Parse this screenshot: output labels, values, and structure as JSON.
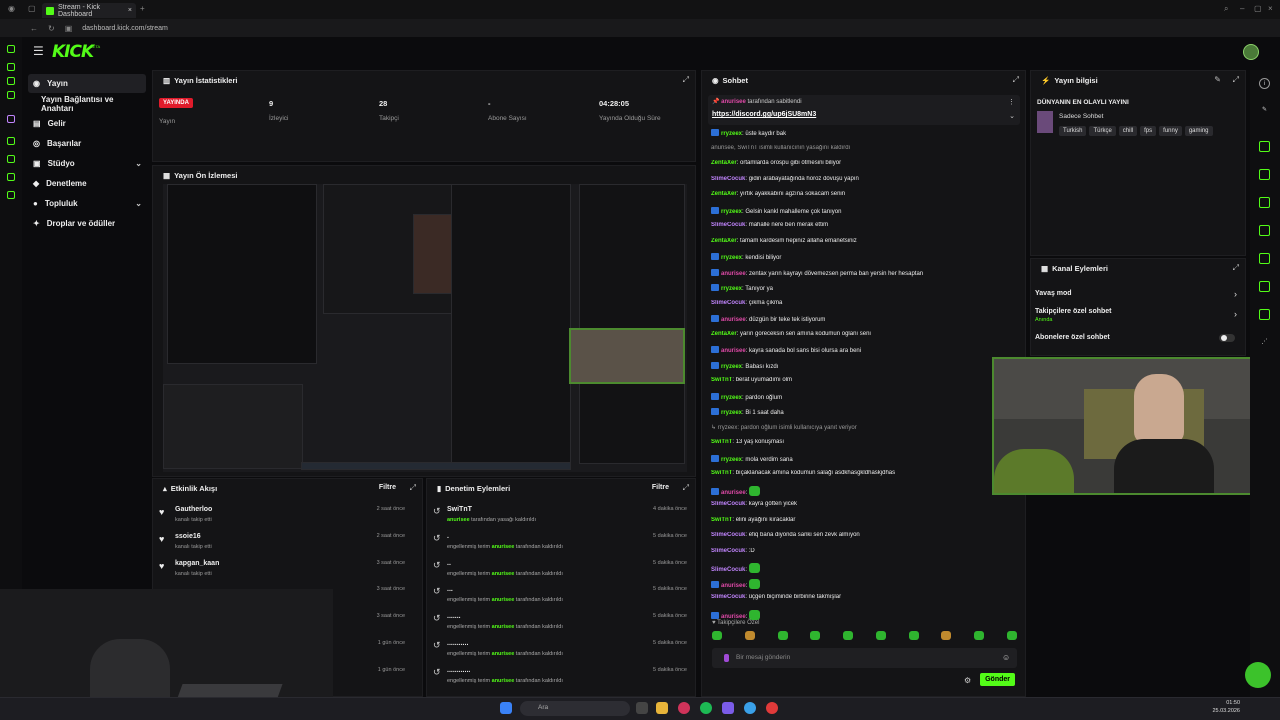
{
  "browser": {
    "tab_title": "Stream - Kick Dashboard",
    "url": "dashboard.kick.com/stream",
    "new_tab_icon": "plus-icon"
  },
  "header": {
    "logo": "KICK",
    "beta": "BETA"
  },
  "sidebar": {
    "items": [
      {
        "label": "Yayın",
        "icon": "broadcast-icon",
        "active": true
      },
      {
        "label": "Yayın Bağlantısı ve Anahtarı",
        "icon": ""
      },
      {
        "label": "Gelir",
        "icon": "money-icon"
      },
      {
        "label": "Başarılar",
        "icon": "trophy-icon"
      },
      {
        "label": "Stüdyo",
        "icon": "studio-icon",
        "chev": "⌄"
      },
      {
        "label": "Denetleme",
        "icon": "shield-icon"
      },
      {
        "label": "Topluluk",
        "icon": "community-icon",
        "chev": "⌄"
      },
      {
        "label": "Droplar ve ödüller",
        "icon": "gift-icon"
      }
    ]
  },
  "stats": {
    "title": "Yayın İstatistikleri",
    "items": [
      {
        "value": "YAYINDA",
        "label": "Yayın"
      },
      {
        "value": "9",
        "label": "İzleyici"
      },
      {
        "value": "28",
        "label": "Takipçi"
      },
      {
        "value": "-",
        "label": "Abone Sayısı"
      },
      {
        "value": "04:28:05",
        "label": "Yayında Olduğu Süre"
      }
    ]
  },
  "preview": {
    "title": "Yayın Ön İzlemesi"
  },
  "activity": {
    "title": "Etkinlik Akışı",
    "filter": "Filtre",
    "rows": [
      {
        "name": "Gautherloo",
        "sub": "kanalı takip etti",
        "time": "2 saat önce"
      },
      {
        "name": "ssoie16",
        "sub": "kanalı takip etti",
        "time": "2 saat önce"
      },
      {
        "name": "kapgan_kaan",
        "sub": "kanalı takip etti",
        "time": "3 saat önce"
      },
      {
        "name": "",
        "sub": "",
        "time": "3 saat önce"
      },
      {
        "name": "",
        "sub": "",
        "time": "3 saat önce"
      },
      {
        "name": "",
        "sub": "",
        "time": "1 gün önce"
      },
      {
        "name": "",
        "sub": "",
        "time": "1 gün önce"
      }
    ]
  },
  "moderation": {
    "title": "Denetim Eylemleri",
    "filter": "Filtre",
    "rows": [
      {
        "name": "SwiTnT",
        "pre": "",
        "who": "anurisee",
        "post": "tarafından yasağı kaldırıldı",
        "time": "4 dakika önce"
      },
      {
        "name": ".",
        "pre": "engellenmiş terim",
        "who": "anurisee",
        "post": "tarafından kaldırıldı",
        "time": "5 dakika önce"
      },
      {
        "name": "..",
        "pre": "engellenmiş terim",
        "who": "anurisee",
        "post": "tarafından kaldırıldı",
        "time": "5 dakika önce"
      },
      {
        "name": "...",
        "pre": "engellenmiş terim",
        "who": "anurisee",
        "post": "tarafından kaldırıldı",
        "time": "5 dakika önce"
      },
      {
        "name": ".......",
        "pre": "engellenmiş terim",
        "who": "anurisee",
        "post": "tarafından kaldırıldı",
        "time": "5 dakika önce"
      },
      {
        "name": "...........",
        "pre": "engellenmiş terim",
        "who": "anurisee",
        "post": "tarafından kaldırıldı",
        "time": "5 dakika önce"
      },
      {
        "name": "............",
        "pre": "engellenmiş terim",
        "who": "anurisee",
        "post": "tarafından kaldırıldı",
        "time": "5 dakika önce"
      }
    ]
  },
  "chat": {
    "title": "Sohbet",
    "pinned_by": "anurisee",
    "pinned_label": "tarafından sabitlendi",
    "pinned_link": "https://discord.gg/up6jSU8mN3",
    "placeholder": "Bir mesaj gönderin",
    "send": "Gönder",
    "followers_only": "Takipçilere Özel",
    "messages": [
      {
        "user": "rryzeex",
        "color": "#53fc18",
        "badge": true,
        "text": "üste kaydır bak"
      },
      {
        "user": "",
        "color": "#999",
        "badge": false,
        "text": "anurisee, SwiTnT isimli kullanıcının yasağını kaldırdı",
        "sys": true
      },
      {
        "user": "ZentaXer",
        "color": "#53fc18",
        "badge": false,
        "text": "ortamlarda orospu gibi ötmesini biliyor"
      },
      {
        "user": "SlimeCocuk",
        "color": "#c084fc",
        "badge": false,
        "text": "gidin arabayatağında horoz dövüşü yapın"
      },
      {
        "user": "ZentaXer",
        "color": "#53fc18",
        "badge": false,
        "text": "yırtık ayakkabını agzına sokacam senin"
      },
      {
        "user": "rryzeex",
        "color": "#53fc18",
        "badge": true,
        "text": "Gelsin kankl mahalleme çok tanıyon"
      },
      {
        "user": "SlimeCocuk",
        "color": "#c084fc",
        "badge": false,
        "text": "mahalle nere ben merak ettim"
      },
      {
        "user": "ZentaXer",
        "color": "#53fc18",
        "badge": false,
        "text": "tamam kardesim hepinız allaha emanetsiniz"
      },
      {
        "user": "rryzeex",
        "color": "#53fc18",
        "badge": true,
        "text": "kendisi biliyor"
      },
      {
        "user": "anurisee",
        "color": "#e04aa8",
        "badge": true,
        "text": "zentax yarın kayrayı dövemezsen perma ban yersin her hesaptan"
      },
      {
        "user": "rryzeex",
        "color": "#53fc18",
        "badge": true,
        "text": "Tanıyor ya"
      },
      {
        "user": "SlimeCocuk",
        "color": "#c084fc",
        "badge": false,
        "text": "çıkma çıkma"
      },
      {
        "user": "anurisee",
        "color": "#e04aa8",
        "badge": true,
        "text": "düzgün bir teke tek istiyorum"
      },
      {
        "user": "ZentaXer",
        "color": "#53fc18",
        "badge": false,
        "text": "yarın goreceksin sen amına kodumun oglanı seni"
      },
      {
        "user": "anurisee",
        "color": "#e04aa8",
        "badge": true,
        "text": "kayra sanada bol sans bisi olursa ara beni"
      },
      {
        "user": "rryzeex",
        "color": "#53fc18",
        "badge": true,
        "text": "Babası kızdı"
      },
      {
        "user": "SwiTnT",
        "color": "#53fc18",
        "badge": false,
        "text": "berat uyumadımı olm"
      },
      {
        "user": "rryzeex",
        "color": "#53fc18",
        "badge": true,
        "text": "pardon oğlum"
      },
      {
        "user": "rryzeex",
        "color": "#53fc18",
        "badge": true,
        "text": "Bi 1 saat daha"
      },
      {
        "user": "",
        "color": "#999",
        "badge": false,
        "text": "↳ rryzeex: pardon oğlum isimli kullanıcıya yanıt veriyor",
        "sys": true
      },
      {
        "user": "SwiTnT",
        "color": "#53fc18",
        "badge": false,
        "text": "13 yaş konuşması"
      },
      {
        "user": "rryzeex",
        "color": "#53fc18",
        "badge": true,
        "text": "mola verdim sana"
      },
      {
        "user": "SwiTnT",
        "color": "#53fc18",
        "badge": false,
        "text": "bıçaklanacak amına kodumun salağı asdkhasgkldhaskjdhas"
      },
      {
        "user": "anurisee",
        "color": "#e04aa8",
        "badge": true,
        "text": "",
        "emote": true
      },
      {
        "user": "SlimeCocuk",
        "color": "#c084fc",
        "badge": false,
        "text": "kayra götten yicek"
      },
      {
        "user": "SwiTnT",
        "color": "#53fc18",
        "badge": false,
        "text": "elini ayağını kıracaklar"
      },
      {
        "user": "SlimeCocuk",
        "color": "#c084fc",
        "badge": false,
        "text": "efiq bana diyonda sanki sen zevk almıyon"
      },
      {
        "user": "SlimeCocuk",
        "color": "#c084fc",
        "badge": false,
        "text": ":D"
      },
      {
        "user": "SlimeCocuk",
        "color": "#c084fc",
        "badge": false,
        "text": "",
        "emote": true
      },
      {
        "user": "anurisee",
        "color": "#e04aa8",
        "badge": true,
        "text": "",
        "emote": true
      },
      {
        "user": "SlimeCocuk",
        "color": "#c084fc",
        "badge": false,
        "text": "üçgen biçiminde birbirine takmışlar"
      },
      {
        "user": "anurisee",
        "color": "#e04aa8",
        "badge": true,
        "text": "",
        "emote": true
      }
    ]
  },
  "info": {
    "title": "Yayın bilgisi",
    "stream_title": "DÜNYANIN EN OLAYLI YAYINI",
    "category": "Sadece Sohbet",
    "tags": [
      "Turkish",
      "Türkçe",
      "chill",
      "fps",
      "funny",
      "gaming"
    ]
  },
  "actions": {
    "title": "Kanal Eylemleri",
    "items": [
      {
        "label": "Yavaş mod",
        "sub": ""
      },
      {
        "label": "Takipçilere özel sohbet",
        "sub": "Anında"
      },
      {
        "label": "Abonelere özel sohbet",
        "sub": ""
      }
    ]
  },
  "taskbar": {
    "search": "Ara",
    "time": "01:50",
    "date": "25.03.2026"
  },
  "colors": {
    "accent": "#53fc18",
    "live": "#e01b2b",
    "panel": "#141416"
  }
}
